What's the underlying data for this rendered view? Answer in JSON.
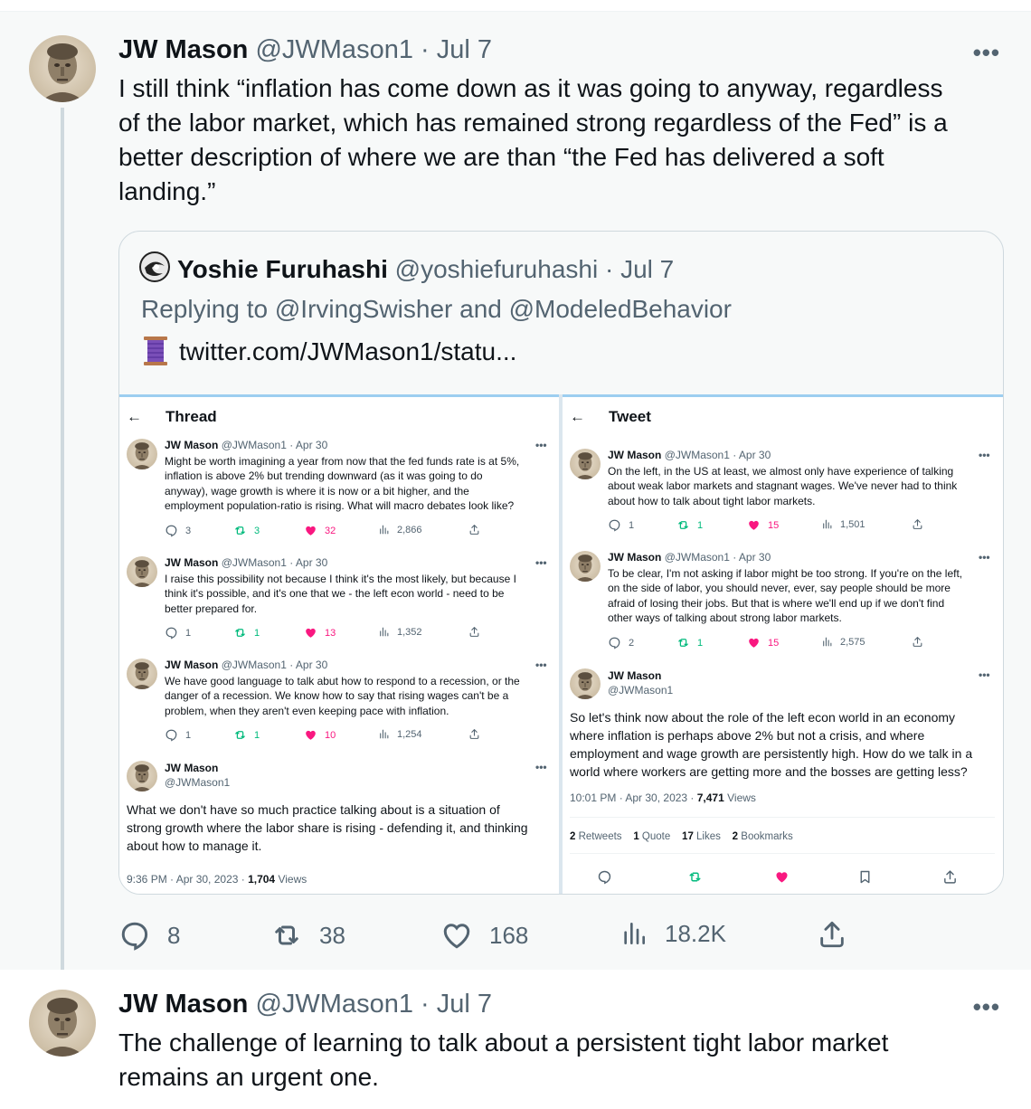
{
  "colors": {
    "like_pink": "#f91880",
    "retweet_green": "#00ba7c",
    "muted": "#536471",
    "quote_border": "#cfd9de"
  },
  "tweet1": {
    "name": "JW Mason",
    "handle": "@JWMason1",
    "sep": "·",
    "date": "Jul 7",
    "more": "•••",
    "text_lines": [
      "I still think “inflation has come down as it was going to anyway, regardless",
      "of the labor market, which has remained strong regardless of the Fed” is a",
      "better description of where we are than “the Fed has delivered a soft",
      "landing.”"
    ],
    "actions": {
      "replies": "8",
      "retweets": "38",
      "likes": "168",
      "views": "18.2K"
    }
  },
  "quote": {
    "name": "Yoshie Furuhashi",
    "handle": "@yoshiefuruhashi",
    "sep": "·",
    "date": "Jul 7",
    "reply": "Replying to @IrvingSwisher and @ModeledBehavior",
    "link": "twitter.com/JWMason1/statu..."
  },
  "left_shot": {
    "arrow": "←",
    "title": "Thread",
    "tweets": [
      {
        "name": "JW Mason",
        "handle": "@JWMason1 · Apr 30",
        "dots": "•••",
        "lines": [
          "Might be worth imagining a year from now that the fed funds rate is at 5%,",
          "inflation is above 2% but trending downward (as it was going to do",
          "anyway), wage growth is where it is now or a bit higher, and the",
          "employment population-ratio is rising. What will macro debates look like?"
        ],
        "replies": "3",
        "retweets": "3",
        "likes": "32",
        "views": "2,866"
      },
      {
        "name": "JW Mason",
        "handle": "@JWMason1 · Apr 30",
        "dots": "•••",
        "lines": [
          "I raise this possibility not because I think it's the most likely, but because I",
          "think it's possible, and it's one that we - the left econ world - need to be",
          "better prepared for."
        ],
        "replies": "1",
        "retweets": "1",
        "likes": "13",
        "views": "1,352"
      },
      {
        "name": "JW Mason",
        "handle": "@JWMason1 · Apr 30",
        "dots": "•••",
        "lines": [
          "We have good language to talk abut how to respond to a recession, or the",
          "danger of a recession. We know how to say that rising wages can't be a",
          "problem, when they aren't even keeping pace with inflation."
        ],
        "replies": "1",
        "retweets": "1",
        "likes": "10",
        "views": "1,254"
      }
    ],
    "main": {
      "name": "JW Mason",
      "handle": "@JWMason1",
      "dots": "•••",
      "lines": [
        "What we don't have so much practice talking about is a situation of",
        "strong growth where the labor share is rising - defending it, and thinking",
        "about how to manage it."
      ],
      "time": "9:36 PM · Apr 30, 2023 · ",
      "views_num": "1,704",
      "views_label": " Views"
    }
  },
  "right_shot": {
    "arrow": "←",
    "title": "Tweet",
    "tweets": [
      {
        "name": "JW Mason",
        "handle": "@JWMason1 · Apr 30",
        "dots": "•••",
        "lines": [
          "On the left, in the US at least, we almost only have experience of talking",
          "about weak labor markets and stagnant wages. We've never had to think",
          "about how to talk about tight labor markets."
        ],
        "replies": "1",
        "retweets": "1",
        "likes": "15",
        "views": "1,501"
      },
      {
        "name": "JW Mason",
        "handle": "@JWMason1 · Apr 30",
        "dots": "•••",
        "lines": [
          "To be clear, I'm not asking if labor might be too strong. If you're on the left,",
          "on the side of labor, you should never, ever, say people should be more",
          "afraid of losing their jobs. But that is where we'll end up if we don't find",
          "other ways of talking about strong labor markets."
        ],
        "replies": "2",
        "retweets": "1",
        "likes": "15",
        "views": "2,575"
      }
    ],
    "main": {
      "name": "JW Mason",
      "handle": "@JWMason1",
      "dots": "•••",
      "lines": [
        "So let's think now about the role of the left econ world in an economy",
        "where inflation is perhaps above 2% but not a crisis, and where",
        "employment and wage growth are persistently high. How do we talk in a",
        "world where workers are getting more and the bosses are getting less?"
      ],
      "time": "10:01 PM · Apr 30, 2023 · ",
      "views_num": "7,471",
      "views_label": " Views",
      "stats": [
        {
          "num": "2",
          "label": " Retweets"
        },
        {
          "num": "1",
          "label": " Quote"
        },
        {
          "num": "17",
          "label": " Likes"
        },
        {
          "num": "2",
          "label": " Bookmarks"
        }
      ]
    }
  },
  "tweet2": {
    "name": "JW Mason",
    "handle": "@JWMason1",
    "sep": "·",
    "date": "Jul 7",
    "more": "•••",
    "text_lines": [
      "The challenge of learning to talk about a persistent tight labor market",
      "remains an urgent one."
    ]
  }
}
